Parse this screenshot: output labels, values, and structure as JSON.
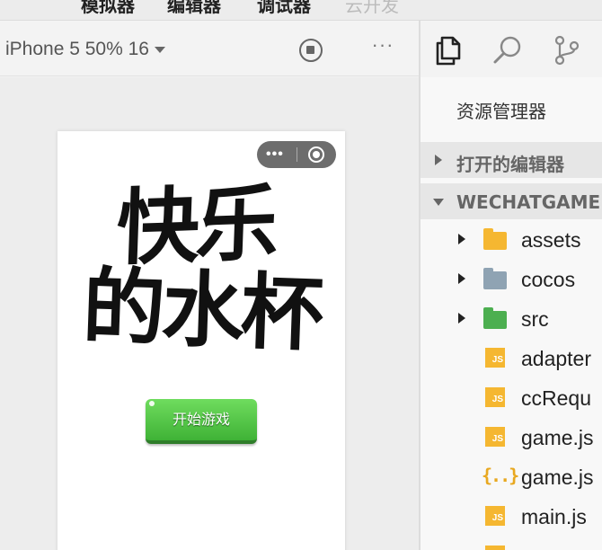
{
  "toolbar": {
    "simulator_label": "模拟器",
    "editor_label": "编辑器",
    "debugger_label": "调试器",
    "cloud_label": "云开发"
  },
  "simulator": {
    "device_label": "iPhone 5 50% 16",
    "game": {
      "title_line1": "快乐",
      "title_line2": "的水杯",
      "start_button_label": "开始游戏"
    }
  },
  "explorer": {
    "title": "资源管理器",
    "open_editors_label": "打开的编辑器",
    "project_label": "WECHATGAME",
    "items": [
      {
        "name": "assets",
        "kind": "folder",
        "icon": "folder-assets-icon",
        "color": "#f5b731"
      },
      {
        "name": "cocos",
        "kind": "folder",
        "icon": "folder-icon",
        "color": "#8fa3b3"
      },
      {
        "name": "src",
        "kind": "folder",
        "icon": "folder-src-icon",
        "color": "#4caf50"
      },
      {
        "name": "adapter",
        "kind": "js",
        "icon": "js-file-icon"
      },
      {
        "name": "ccRequ",
        "kind": "js",
        "icon": "js-file-icon"
      },
      {
        "name": "game.js",
        "kind": "js",
        "icon": "js-file-icon"
      },
      {
        "name": "game.js",
        "kind": "json",
        "icon": "json-file-icon"
      },
      {
        "name": "main.js",
        "kind": "js",
        "icon": "js-file-icon"
      }
    ]
  },
  "colors": {
    "start_button": "#3fb236",
    "js_badge": "#f5b731",
    "capsule": "#6d6d6d"
  }
}
